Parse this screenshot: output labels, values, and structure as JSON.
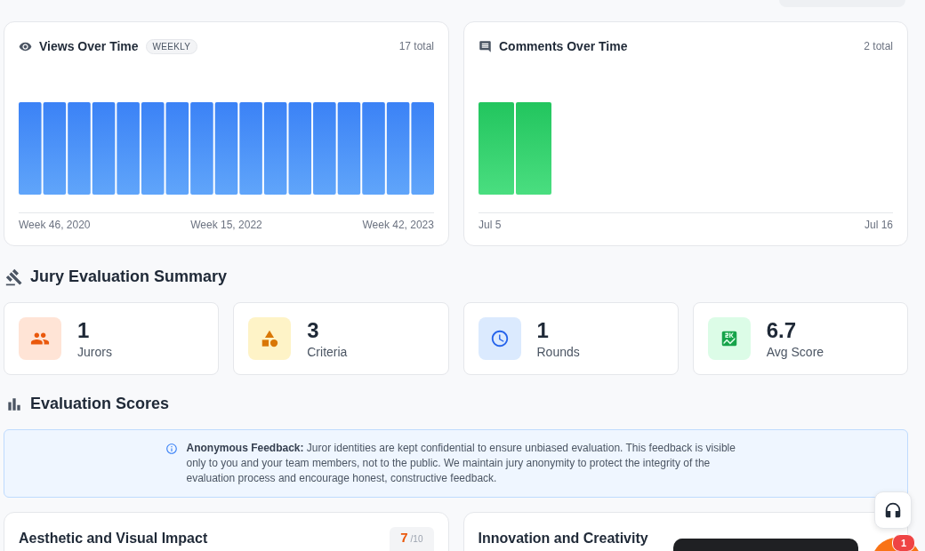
{
  "charts": [
    {
      "kind": "views",
      "title": "Views Over Time",
      "badge": "WEEKLY",
      "total": "17 total",
      "x_labels": [
        "Week 46, 2020",
        "Week 15, 2022",
        "Week 42, 2023"
      ]
    },
    {
      "kind": "comments",
      "title": "Comments Over Time",
      "total": "2 total",
      "x_labels": [
        "Jul 5",
        "Jul 16"
      ]
    }
  ],
  "jury": {
    "title": "Jury Evaluation Summary",
    "stats": [
      {
        "kind": "jurors",
        "value": "1",
        "label": "Jurors"
      },
      {
        "kind": "criteria",
        "value": "3",
        "label": "Criteria"
      },
      {
        "kind": "rounds",
        "value": "1",
        "label": "Rounds"
      },
      {
        "kind": "score",
        "value": "6.7",
        "label": "Avg Score"
      }
    ]
  },
  "evaluation": {
    "title": "Evaluation Scores",
    "notice": "**Anonymous Feedback:** Juror identities are kept confidential to ensure unbiased evaluation. This feedback is visible only to you and your team members, not to the public. We maintain jury anonymity to protect the integrity of the evaluation process and encourage honest, constructive feedback.",
    "criteria": [
      {
        "title": "Aesthetic and Visual Impact",
        "score": "7",
        "max": "/10"
      },
      {
        "title": "Innovation and Creativity"
      }
    ]
  },
  "notification_badge": "1"
}
